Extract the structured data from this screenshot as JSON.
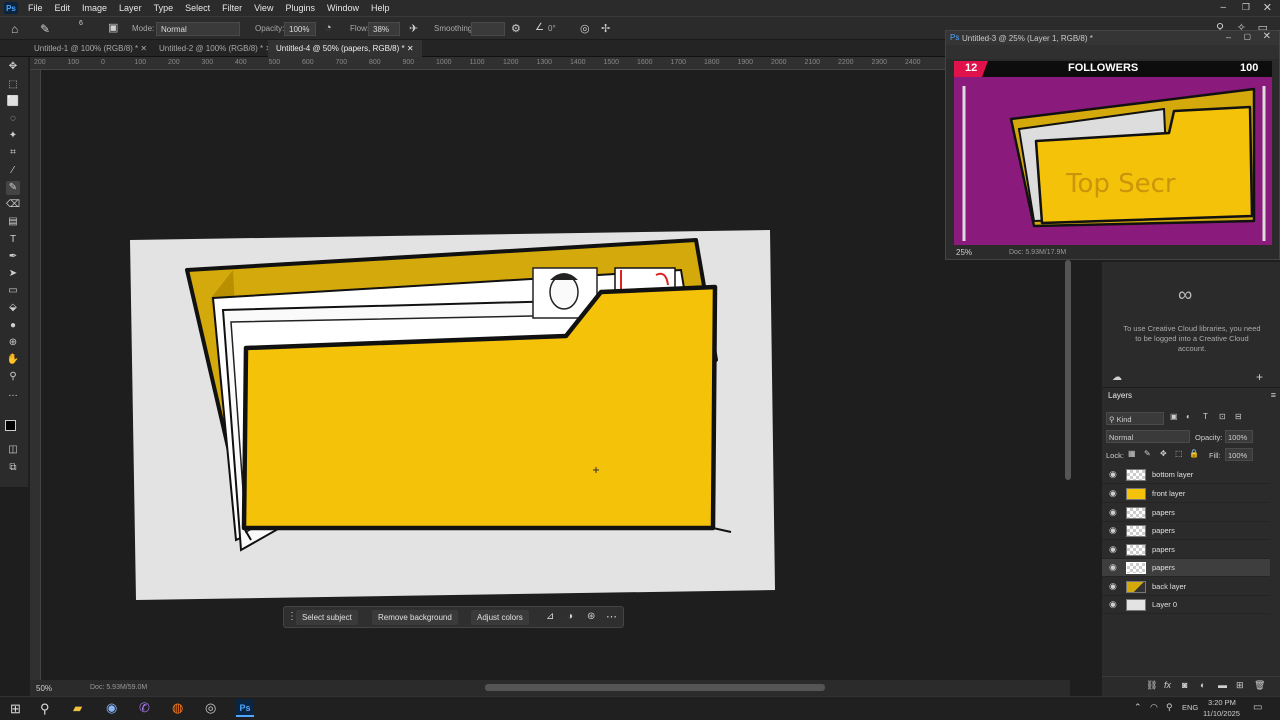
{
  "menu": [
    "File",
    "Edit",
    "Image",
    "Layer",
    "Type",
    "Select",
    "Filter",
    "View",
    "Plugins",
    "Window",
    "Help"
  ],
  "app_logo": "Ps",
  "options": {
    "mode_label": "Mode:",
    "mode_value": "Normal",
    "opacity_label": "Opacity:",
    "opacity_value": "100%",
    "flow_label": "Flow:",
    "flow_value": "38%",
    "smoothing_label": "Smoothing:",
    "angle_value": "0°",
    "brush_size": "6"
  },
  "tabs": [
    {
      "label": "Untitled-1 @ 100% (RGB/8) *"
    },
    {
      "label": "Untitled-2 @ 100% (RGB/8) *"
    },
    {
      "label": "Untitled-4 @ 50% (papers, RGB/8) *"
    }
  ],
  "ruler_top": [
    "200",
    "100",
    "0",
    "100",
    "200",
    "300",
    "400",
    "500",
    "600",
    "700",
    "800",
    "900",
    "1000",
    "1100",
    "1200",
    "1300",
    "1400",
    "1500",
    "1600",
    "1700",
    "1800",
    "1900",
    "2000",
    "2100",
    "2200",
    "2300",
    "2400"
  ],
  "context_bar": {
    "select_subject": "Select subject",
    "remove_background": "Remove background",
    "adjust_colors": "Adjust colors"
  },
  "status": {
    "zoom": "50%",
    "doc": "Doc: 5.93M/59.0M"
  },
  "float_window": {
    "title": "Untitled-3 @ 25% (Layer 1, RGB/8) *",
    "banner_left": "12",
    "banner_mid": "FOLLOWERS",
    "banner_right": "100",
    "stamp": "Top Secr",
    "zoom": "25%",
    "doc": "Doc: 5.93M/17.9M"
  },
  "cc_panel": {
    "message": "To use Creative Cloud libraries, you need to be logged into a Creative Cloud account."
  },
  "layers_panel": {
    "title": "Layers",
    "filter": "Kind",
    "blend": "Normal",
    "opacity_label": "Opacity:",
    "opacity": "100%",
    "lock_label": "Lock:",
    "fill_label": "Fill:",
    "fill": "100%",
    "items": [
      {
        "name": "bottom layer",
        "thumb": "checker"
      },
      {
        "name": "front layer",
        "thumb": "yellow"
      },
      {
        "name": "papers",
        "thumb": "checker"
      },
      {
        "name": "papers",
        "thumb": "checker"
      },
      {
        "name": "papers",
        "thumb": "checker"
      },
      {
        "name": "papers",
        "thumb": "checker",
        "selected": true
      },
      {
        "name": "back layer",
        "thumb": "folder"
      },
      {
        "name": "Layer 0",
        "thumb": "light"
      }
    ]
  },
  "taskbar": {
    "lang": "ENG",
    "time": "3:20 PM",
    "date": "11/10/2025"
  },
  "colors": {
    "accent": "#f5c20a",
    "panel": "#2b2b2b",
    "canvas_bg": "#e3e3e3",
    "purple": "#8a1b7d"
  }
}
